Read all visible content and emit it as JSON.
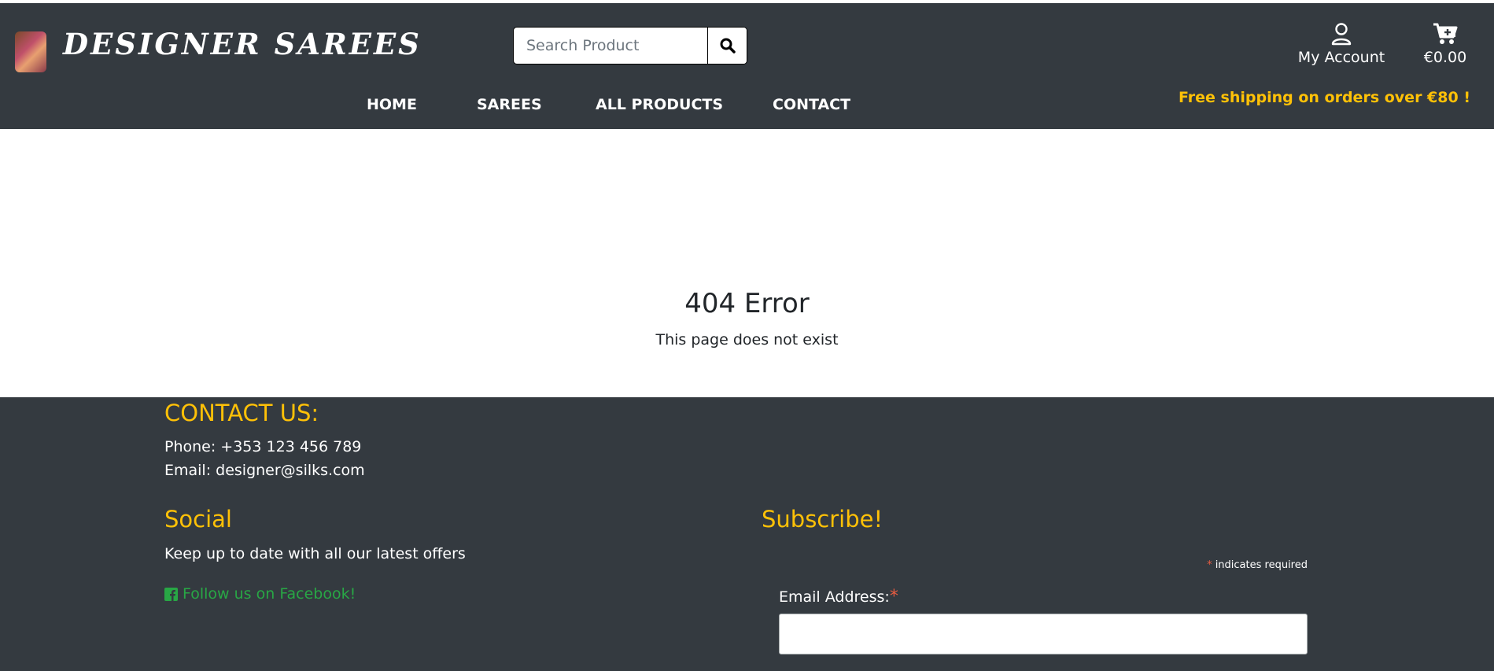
{
  "header": {
    "brand": "DESIGNER SAREES",
    "search": {
      "placeholder": "Search Product",
      "value": ""
    },
    "account_label": "My Account",
    "cart_total": "€0.00",
    "shipping_banner": "Free shipping on orders over €80 !"
  },
  "nav": {
    "items": [
      {
        "label": "HOME"
      },
      {
        "label": "SAREES"
      },
      {
        "label": "ALL PRODUCTS"
      },
      {
        "label": "CONTACT"
      }
    ]
  },
  "main": {
    "error_title": "404 Error",
    "error_message": "This page does not exist"
  },
  "footer": {
    "contact_heading": "CONTACT US:",
    "phone": "Phone: +353 123 456 789",
    "email": "Email: designer@silks.com",
    "social_heading": "Social",
    "social_text": "Keep up to date with all our latest offers",
    "facebook_link": "Follow us on Facebook!",
    "subscribe_heading": "Subscribe!",
    "required_asterisk": "*",
    "required_note": " indicates required",
    "email_label": "Email Address:",
    "email_value": ""
  },
  "colors": {
    "dark_bg": "#343a40",
    "accent_yellow": "#ffc107",
    "link_green": "#28a745",
    "required_red": "#e85c41"
  }
}
